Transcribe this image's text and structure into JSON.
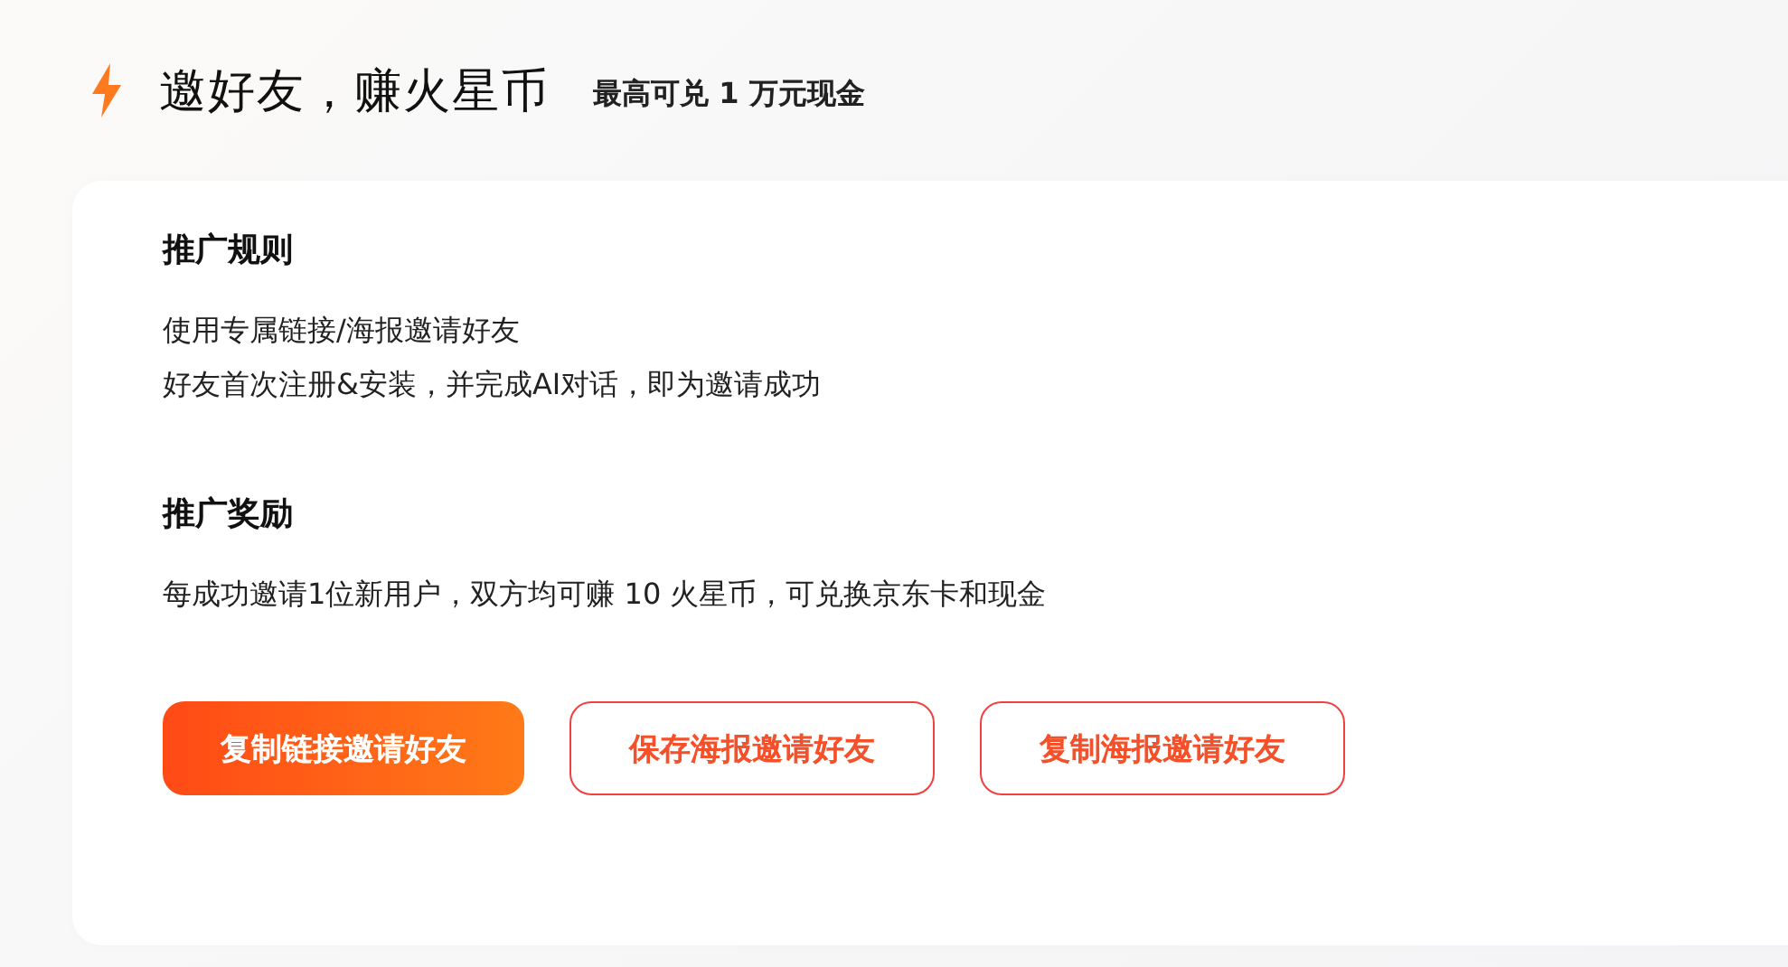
{
  "header": {
    "title": "邀好友，赚火星币",
    "subtitle": "最高可兑 1 万元现金"
  },
  "sections": [
    {
      "heading": "推广规则",
      "lines": [
        "使用专属链接/海报邀请好友",
        "好友首次注册&安装，并完成AI对话，即为邀请成功"
      ]
    },
    {
      "heading": "推广奖励",
      "lines": [
        "每成功邀请1位新用户，双方均可赚 10 火星币，可兑换京东卡和现金"
      ]
    }
  ],
  "buttons": [
    {
      "label": "复制链接邀请好友",
      "kind": "primary"
    },
    {
      "label": "保存海报邀请好友",
      "kind": "outline"
    },
    {
      "label": "复制海报邀请好友",
      "kind": "outline"
    }
  ]
}
